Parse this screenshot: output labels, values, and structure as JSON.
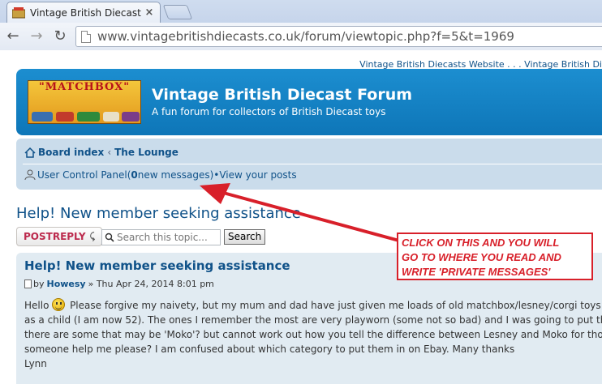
{
  "browser": {
    "tab_title": "Vintage British Diecast For",
    "tab_close": "×",
    "url": "www.vintagebritishdiecasts.co.uk/forum/viewtopic.php?f=5&t=1969",
    "nav_back": "←",
    "nav_forward": "→",
    "nav_reload": "↻"
  },
  "page": {
    "top_links": "Vintage British Diecasts Website . . . Vintage British Di",
    "header": {
      "logo_text": "\"MATCHBOX\"",
      "site_title": "Vintage British Diecast Forum",
      "site_description": "A fun forum for collectors of British Diecast toys"
    },
    "breadcrumbs": {
      "board_index": "Board index",
      "separator": "‹",
      "the_lounge": "The Lounge"
    },
    "ucp": {
      "user_control_panel": "User Control Panel",
      "open_paren": " (",
      "message_count": "0",
      "new_messages": " new messages",
      "close_paren": ")",
      "bullet": " • ",
      "view_posts": "View your posts"
    },
    "topic_title": "Help! New member seeking assistance",
    "post_reply_label": "POSTREPLY",
    "post_reply_icon": "⤹",
    "search": {
      "placeholder": "Search this topic...",
      "button_label": "Search"
    },
    "post": {
      "title": "Help! New member seeking assistance",
      "by": "by",
      "author": "Howesy",
      "date": "» Thu Apr 24, 2014 8:01 pm",
      "hello": "Hello",
      "line1": " Please forgive my naivety, but my mum and dad have just given me loads of old matchbox/lesney/corgi toys etc",
      "line2": "as a child (I am now 52). The ones I remember the most are very playworn (some not so bad) and I was going to put them",
      "line3": "there are some that may be 'Moko'? but cannot work out how you tell the difference between Lesney and Moko for those o",
      "line4": "someone help me please? I am confused about which category to put them in on Ebay. Many thanks",
      "signature": "Lynn"
    }
  },
  "annotation": {
    "line1": "CLICK ON THIS AND YOU WILL",
    "line2": "GO TO WHERE YOU READ AND",
    "line3": " WRITE 'PRIVATE MESSAGES'",
    "color": "#d8202a"
  },
  "colors": {
    "link_blue": "#105289",
    "header_blue": "#1c8ed0",
    "navbar_bg": "#cadceb",
    "post_bg": "#e1ebf2",
    "reply_red": "#bc2a4d"
  }
}
